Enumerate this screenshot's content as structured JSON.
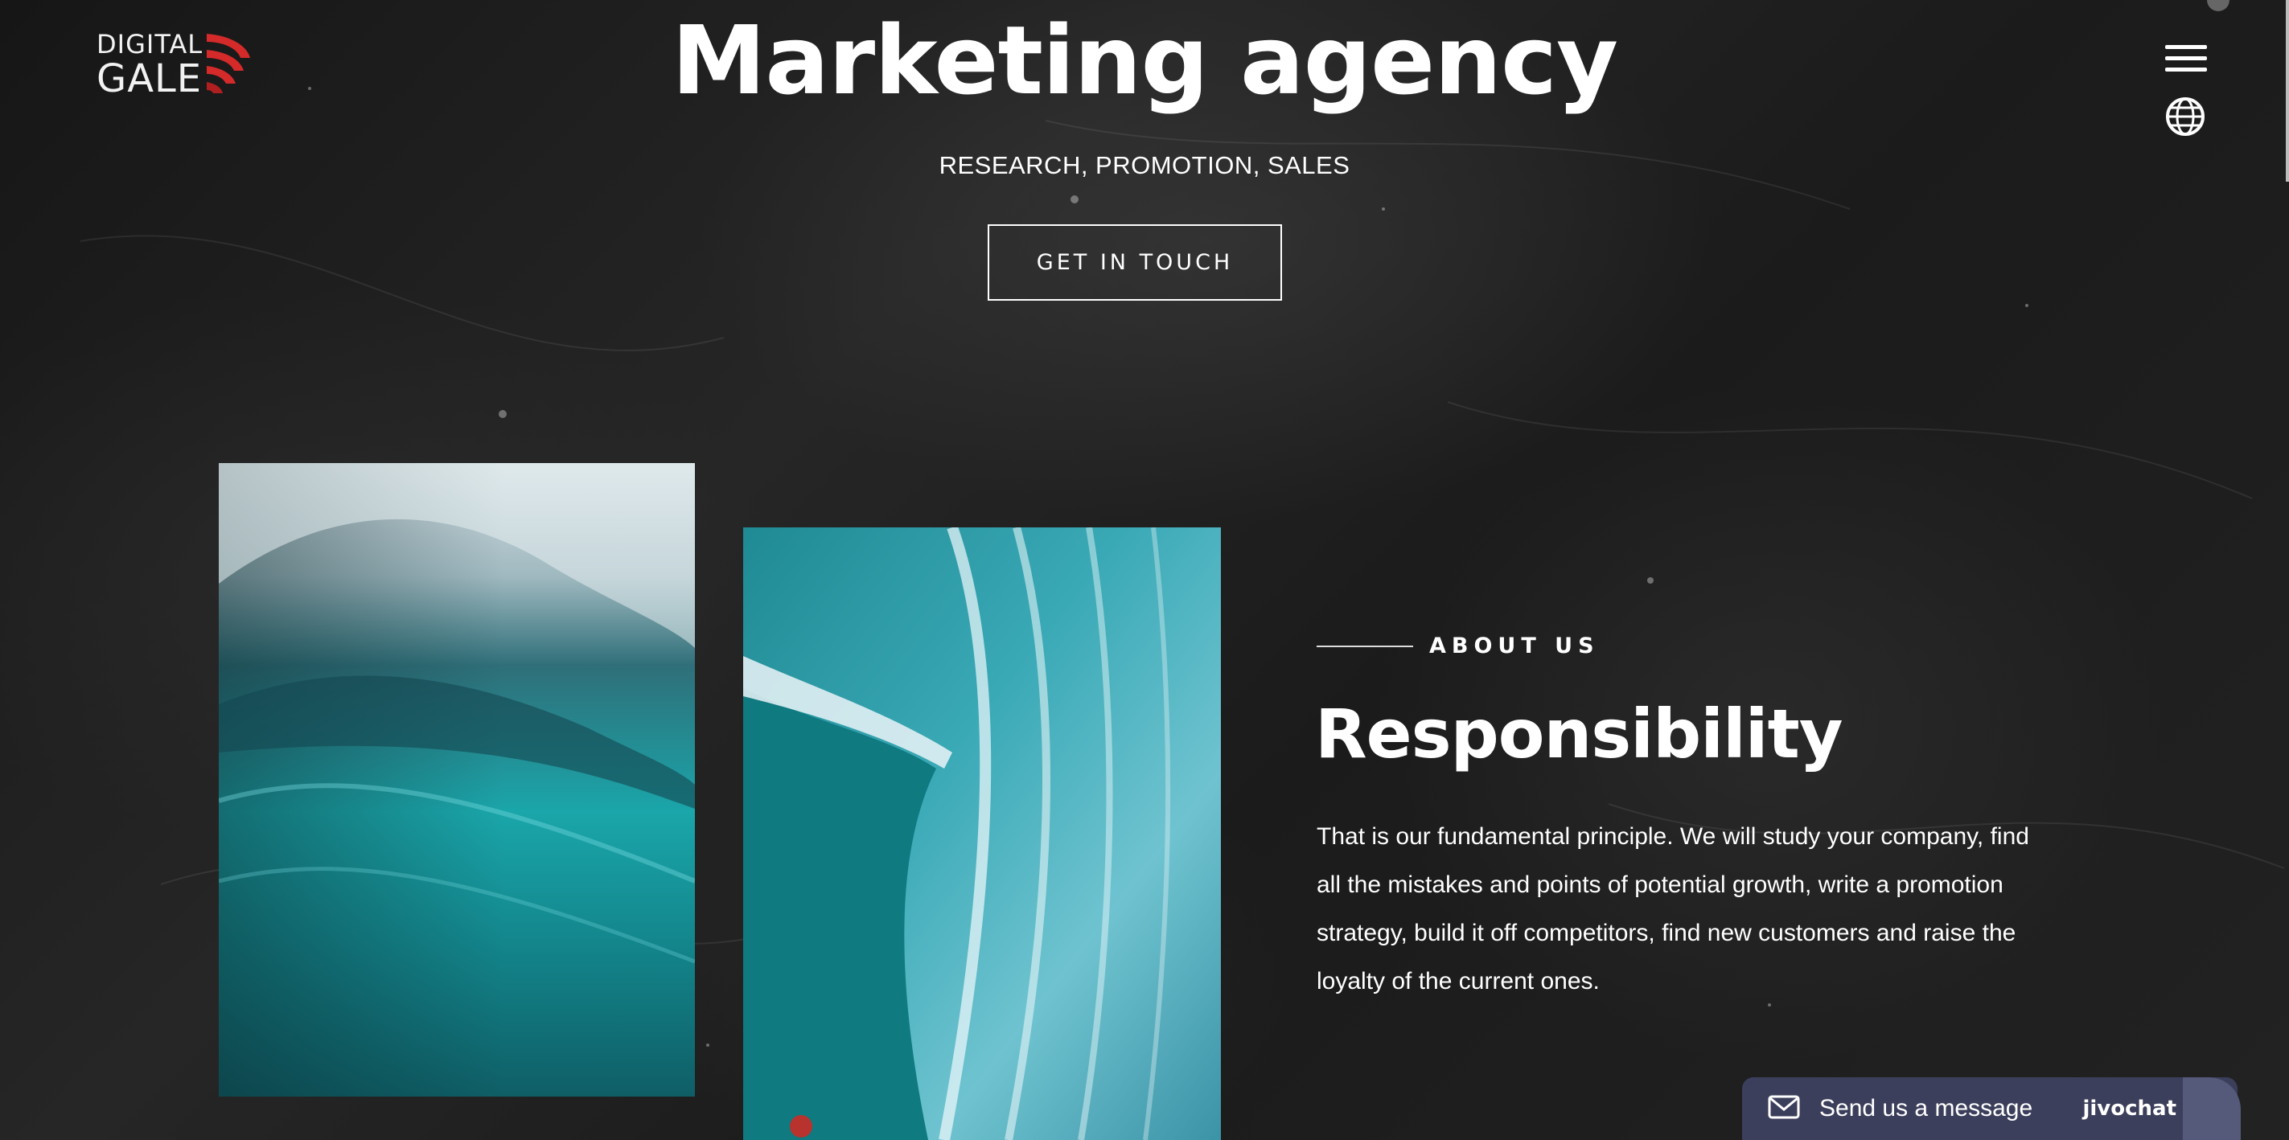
{
  "header": {
    "logo": {
      "line1": "DIGITAL",
      "line2": "GALE",
      "accent_color": "#d42a2a"
    },
    "menu_icon": "hamburger-menu-icon",
    "language_icon": "globe-icon"
  },
  "hero": {
    "title": "Marketing agency",
    "subtitle": "RESEARCH, PROMOTION, SALES",
    "cta_label": "GET IN TOUCH"
  },
  "about": {
    "label": "ABOUT US",
    "heading": "Responsibility",
    "body": "That is our fundamental principle. We will study your company, find all the mistakes and points of potential growth, write a promotion strategy, build it off competitors, find new customers and raise the loyalty of the current ones."
  },
  "chat_widget": {
    "label": "Send us a message",
    "brand": "jivochat",
    "icon": "envelope-icon",
    "background_color": "#3c3f5c"
  },
  "colors": {
    "background": "#1c1c1c",
    "text": "#ffffff",
    "wave_teal": "#1a9aa0"
  }
}
